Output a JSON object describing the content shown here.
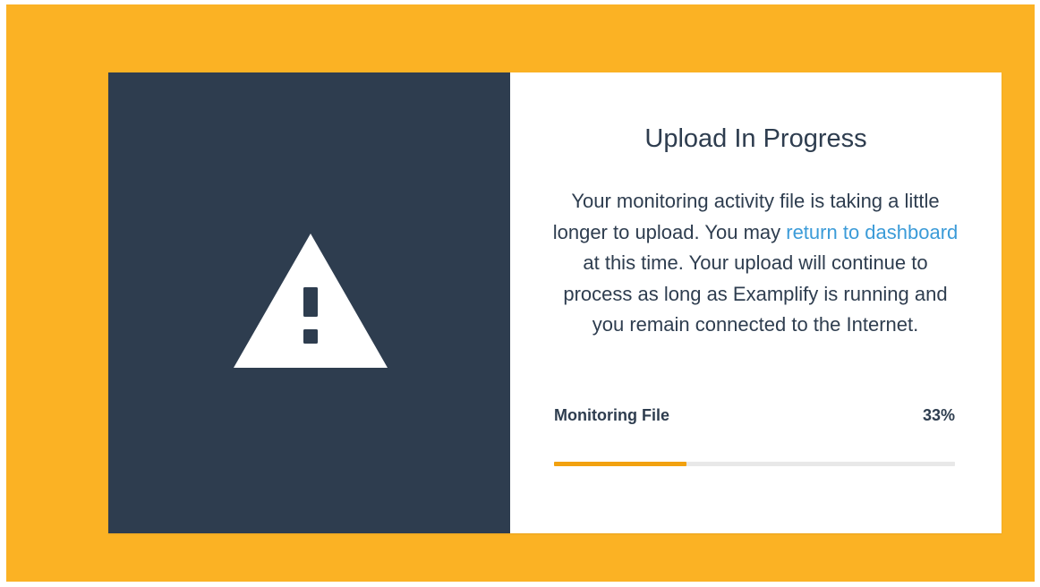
{
  "dialog": {
    "icon": "warning-triangle-icon",
    "title": "Upload In Progress",
    "message": {
      "part1": "Your monitoring activity file is taking a little longer to upload. You may ",
      "link_text": "return to dashboard",
      "part2": " at this time. Your upload will continue to process as long as Examplify is running and you remain connected to the Internet."
    },
    "progress": {
      "label": "Monitoring File",
      "percent_text": "33%",
      "value": 0.33
    }
  },
  "colors": {
    "background": "#FBB224",
    "left_panel": "#2E3D4F",
    "text": "#2E3D4F",
    "link": "#3B9BD8",
    "progress_fill": "#F2A10F",
    "progress_track": "#E8E8E8"
  }
}
